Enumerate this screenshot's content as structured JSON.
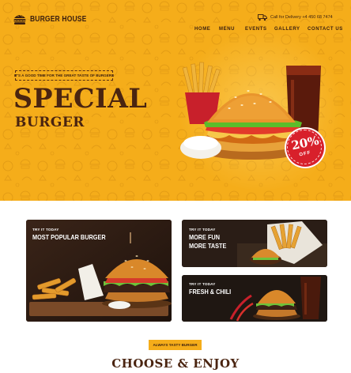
{
  "brand": {
    "name": "BURGER HOUSE"
  },
  "header": {
    "delivery_text": "Call for Delivery +4 450 68 7474",
    "nav": [
      {
        "label": "HOME"
      },
      {
        "label": "MENU"
      },
      {
        "label": "EVENTS"
      },
      {
        "label": "GALLERY"
      },
      {
        "label": "CONTACT US"
      }
    ]
  },
  "hero": {
    "tagline": "IT'S A GOOD TIME FOR THE GREAT TASTE OF BURGERS",
    "title": "SPECIAL",
    "subtitle": "BURGER",
    "badge_percent": "20%",
    "badge_label": "OFF"
  },
  "promos": [
    {
      "eyebrow": "TRY IT TODAY",
      "title": "MOST POPULAR BURGER"
    },
    {
      "eyebrow": "TRY IT TODAY",
      "title_line1": "MORE FUN",
      "title_line2": "MORE TASTE"
    },
    {
      "eyebrow": "TRY IT TODAY",
      "title": "FRESH & CHILI"
    }
  ],
  "section": {
    "pill": "ALWAYS TASTY BURGER",
    "heading": "CHOOSE & ENJOY"
  },
  "colors": {
    "accent": "#f5ad1a",
    "dark_brown": "#4a2410",
    "badge_red": "#d8202b"
  },
  "icons": [
    "burger-logo-icon",
    "delivery-truck-icon"
  ]
}
